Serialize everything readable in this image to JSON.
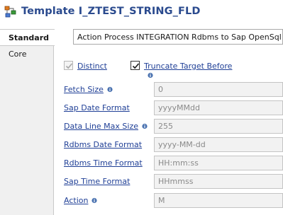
{
  "window": {
    "title": "Template I_ZTEST_STRING_FLD",
    "icon": "template-icon",
    "title_color": "#2a4a8e"
  },
  "sidebar": {
    "tabs": [
      {
        "label": "Standard",
        "active": true
      },
      {
        "label": "Core",
        "active": false
      }
    ]
  },
  "main": {
    "description": "Action Process INTEGRATION Rdbms to Sap OpenSql",
    "checkboxes": [
      {
        "label": "Distinct",
        "checked": true,
        "enabled": false,
        "has_info": false
      },
      {
        "label": "Truncate Target Before",
        "checked": true,
        "enabled": true,
        "has_info": true
      }
    ],
    "fields": [
      {
        "label": "Fetch Size",
        "value": "0",
        "has_info": true
      },
      {
        "label": "Sap Date Format",
        "value": "yyyyMMdd",
        "has_info": false
      },
      {
        "label": "Data Line Max Size",
        "value": "255",
        "has_info": true
      },
      {
        "label": "Rdbms Date Format",
        "value": "yyyy-MM-dd",
        "has_info": false
      },
      {
        "label": "Rdbms Time Format",
        "value": "HH:mm:ss",
        "has_info": false
      },
      {
        "label": "Sap Time Format",
        "value": "HHmmss",
        "has_info": false
      },
      {
        "label": "Action",
        "value": "M",
        "has_info": true
      }
    ]
  }
}
